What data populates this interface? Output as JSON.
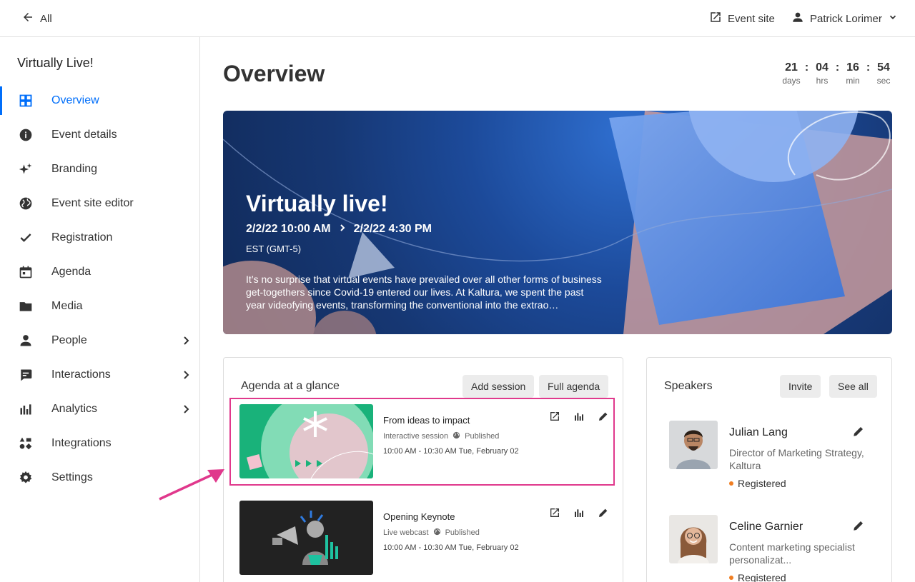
{
  "topbar": {
    "back_label": "All",
    "event_site_label": "Event site",
    "user_name": "Patrick Lorimer"
  },
  "sidebar": {
    "title": "Virtually Live!",
    "items": [
      {
        "label": "Overview",
        "icon": "grid-icon",
        "active": true
      },
      {
        "label": "Event details",
        "icon": "info-icon"
      },
      {
        "label": "Branding",
        "icon": "sparkles-icon"
      },
      {
        "label": "Event site editor",
        "icon": "globe-icon"
      },
      {
        "label": "Registration",
        "icon": "check-icon"
      },
      {
        "label": "Agenda",
        "icon": "calendar-icon"
      },
      {
        "label": "Media",
        "icon": "folder-icon"
      },
      {
        "label": "People",
        "icon": "person-icon",
        "has_submenu": true
      },
      {
        "label": "Interactions",
        "icon": "chat-icon",
        "has_submenu": true
      },
      {
        "label": "Analytics",
        "icon": "bar-chart-icon",
        "has_submenu": true
      },
      {
        "label": "Integrations",
        "icon": "integrations-icon"
      },
      {
        "label": "Settings",
        "icon": "gear-icon"
      }
    ]
  },
  "main": {
    "title": "Overview",
    "countdown": [
      {
        "value": "21",
        "label": "days"
      },
      {
        "value": "04",
        "label": "hrs"
      },
      {
        "value": "16",
        "label": "min"
      },
      {
        "value": "54",
        "label": "sec"
      }
    ],
    "countdown_separator": ":",
    "hero": {
      "title": "Virtually live!",
      "start": "2/2/22 10:00 AM",
      "end": "2/2/22 4:30 PM",
      "timezone": "EST (GMT-5)",
      "description": "It’s no surprise that virtual events have prevailed over all other forms of business get-togethers since Covid-19 entered our lives. At Kaltura, we spent the past year videofying events, transforming the conventional into the extrao…"
    },
    "agenda": {
      "title": "Agenda at a glance",
      "add_label": "Add session",
      "full_label": "Full agenda",
      "sessions": [
        {
          "title": "From ideas to impact",
          "type": "Interactive session",
          "status": "Published",
          "time": "10:00 AM - 10:30 AM",
          "date": "Tue, February 02"
        },
        {
          "title": "Opening Keynote",
          "type": "Live webcast",
          "status": "Published",
          "time": "10:00 AM - 10:30 AM",
          "date": "Tue, February 02"
        }
      ]
    },
    "speakers": {
      "title": "Speakers",
      "invite_label": "Invite",
      "see_all_label": "See all",
      "list": [
        {
          "name": "Julian Lang",
          "role": "Director of Marketing Strategy, Kaltura",
          "status": "Registered"
        },
        {
          "name": "Celine Garnier",
          "role": "Content marketing specialist personalizat...",
          "status": "Registered"
        }
      ]
    }
  },
  "colors": {
    "accent": "#006efa",
    "highlight": "#e0388c",
    "registered_dot": "#f07e22"
  }
}
